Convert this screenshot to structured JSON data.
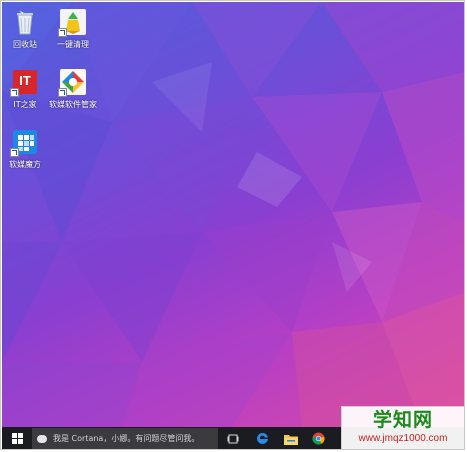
{
  "desktop": {
    "icons": [
      {
        "label": "回收站",
        "icon": "recycle-bin-icon"
      },
      {
        "label": "一键清理",
        "icon": "cleanup-icon"
      },
      {
        "label": "IT之家",
        "icon": "ithome-icon",
        "badge": "IT"
      },
      {
        "label": "软媒软件管家",
        "icon": "software-manager-icon"
      },
      {
        "label": "软媒魔方",
        "icon": "cube-icon"
      }
    ]
  },
  "taskbar": {
    "search_placeholder": "我是 Cortana，小娜。有问题尽管问我。",
    "apps": [
      "task-view-icon",
      "edge-icon",
      "file-explorer-icon",
      "chrome-icon"
    ]
  },
  "watermark": {
    "title": "学知网",
    "url": "www.jmqz1000.com"
  },
  "colors": {
    "taskbar_bg": "#1b1b22",
    "search_bg": "#3a3a3f",
    "watermark_title": "#1a8a1a",
    "watermark_url": "#cc1f1f"
  }
}
